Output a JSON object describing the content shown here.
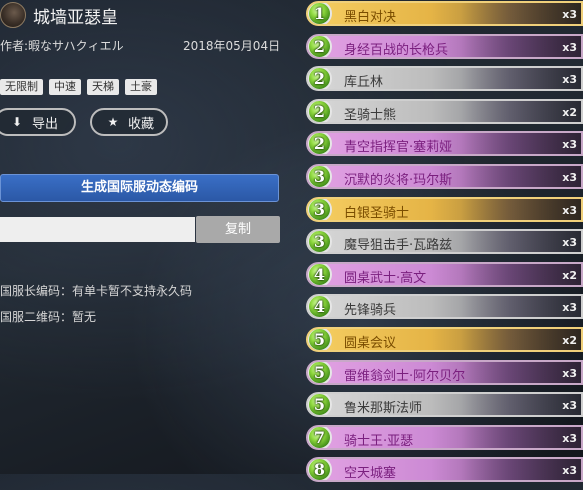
{
  "deck": {
    "title": "城墙亚瑟皇",
    "author": "作者:暇なサハクィエル",
    "date": "2018年05月04日",
    "tags": [
      "无限制",
      "中速",
      "天梯",
      "土豪"
    ]
  },
  "actions": {
    "export_label": "导出",
    "collect_label": "收藏",
    "generate_label": "生成国际服动态编码",
    "code_value": "",
    "copy_label": "复制"
  },
  "info": {
    "cn_code": "国服长编码：有单卡暂不支持永久码",
    "cn_qr": "国服二维码：暂无"
  },
  "colors": {
    "purple": "#d898dc",
    "grey": "#c8c8c8",
    "gold": "#eec252",
    "mana": "#6ec12c",
    "button_blue": "#3466b8"
  },
  "cards": [
    {
      "cost": "1",
      "name": "黑白对决",
      "qty": "x3",
      "rarity": "gold"
    },
    {
      "cost": "2",
      "name": "身经百战的长枪兵",
      "qty": "x3",
      "rarity": "purple"
    },
    {
      "cost": "2",
      "name": "库丘林",
      "qty": "x3",
      "rarity": "grey"
    },
    {
      "cost": "2",
      "name": "圣骑士熊",
      "qty": "x2",
      "rarity": "grey"
    },
    {
      "cost": "2",
      "name": "青空指挥官·塞莉娅",
      "qty": "x3",
      "rarity": "purple"
    },
    {
      "cost": "3",
      "name": "沉默的炎将·玛尔斯",
      "qty": "x3",
      "rarity": "purple"
    },
    {
      "cost": "3",
      "name": "白银圣骑士",
      "qty": "x3",
      "rarity": "gold"
    },
    {
      "cost": "3",
      "name": "魔导狙击手·瓦路兹",
      "qty": "x3",
      "rarity": "grey"
    },
    {
      "cost": "4",
      "name": "圆桌武士·高文",
      "qty": "x2",
      "rarity": "purple"
    },
    {
      "cost": "4",
      "name": "先锋骑兵",
      "qty": "x3",
      "rarity": "grey"
    },
    {
      "cost": "5",
      "name": "圆桌会议",
      "qty": "x2",
      "rarity": "gold"
    },
    {
      "cost": "5",
      "name": "雷维翁剑士·阿尔贝尔",
      "qty": "x3",
      "rarity": "purple"
    },
    {
      "cost": "5",
      "name": "鲁米那斯法师",
      "qty": "x3",
      "rarity": "grey"
    },
    {
      "cost": "7",
      "name": "骑士王·亚瑟",
      "qty": "x3",
      "rarity": "purple"
    },
    {
      "cost": "8",
      "name": "空天城塞",
      "qty": "x3",
      "rarity": "purple"
    }
  ]
}
